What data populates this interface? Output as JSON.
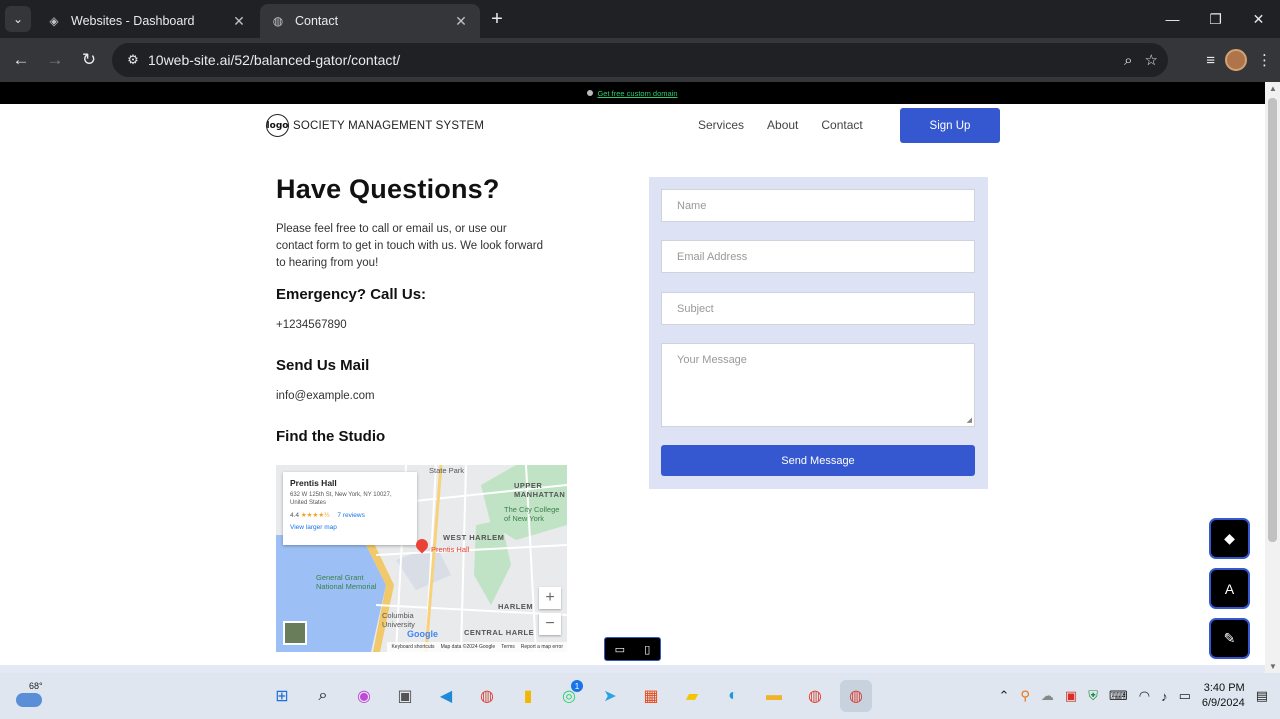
{
  "browser": {
    "tabs": [
      {
        "title": "Websites - Dashboard",
        "icon": "diamond-icon"
      },
      {
        "title": "Contact",
        "icon": "globe-icon"
      }
    ],
    "url": "10web-site.ai/52/balanced-gator/contact/"
  },
  "banner": {
    "link_text": "Get free custom domain"
  },
  "header": {
    "logo_mark": "logo",
    "brand": "SOCIETY MANAGEMENT SYSTEM",
    "nav": [
      "Services",
      "About",
      "Contact"
    ],
    "signup": "Sign Up"
  },
  "contact": {
    "heading": "Have Questions?",
    "intro": "Please feel free to call or email us, or use our contact form to get in touch with us. We look forward to hearing from you!",
    "emergency_heading": "Emergency? Call Us:",
    "phone": "+1234567890",
    "mail_heading": "Send Us Mail",
    "email": "info@example.com",
    "studio_heading": "Find the Studio"
  },
  "map": {
    "place": "Prentis Hall",
    "address": "632 W 125th St, New York, NY 10027, United States",
    "rating": "4.4",
    "stars": "★★★★½",
    "reviews": "7 reviews",
    "larger_map": "View larger map",
    "pin_label": "Prentis Hall",
    "labels": [
      "State Park",
      "UPPER MANHATTAN",
      "The City College of New York",
      "WEST HARLEM",
      "General Grant National Memorial",
      "HARLEM",
      "Columbia University",
      "CENTRAL HARLE"
    ],
    "footer": [
      "Keyboard shortcuts",
      "Map data ©2024 Google",
      "Terms",
      "Report a map error"
    ],
    "google": "Google"
  },
  "form": {
    "name_placeholder": "Name",
    "email_placeholder": "Email Address",
    "subject_placeholder": "Subject",
    "message_placeholder": "Your Message",
    "send": "Send Message"
  },
  "taskbar": {
    "temperature": "68°",
    "time": "3:40 PM",
    "date": "6/9/2024",
    "whatsapp_badge": "1"
  }
}
